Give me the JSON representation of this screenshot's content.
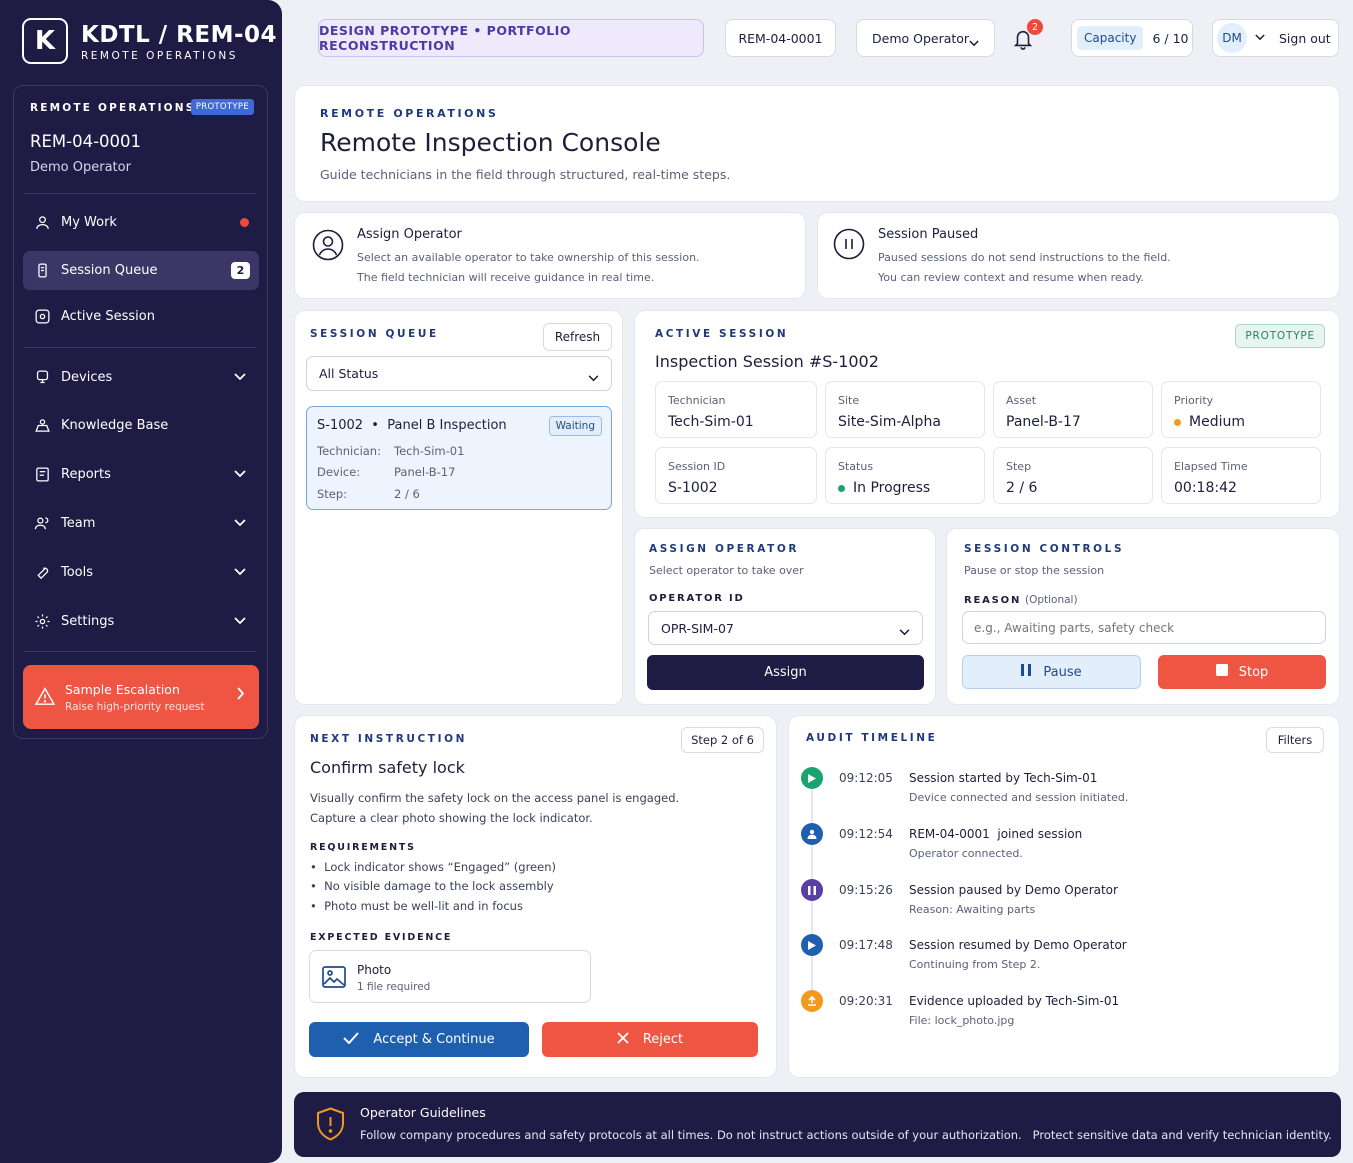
{
  "brand": {
    "logo_letter": "K",
    "title": "KDTL / REM-04",
    "subtitle": "REMOTE OPERATIONS"
  },
  "sidebar": {
    "panel_heading": "REMOTE OPERATIONS",
    "panel_badge": "PROTOTYPE",
    "session_id": "REM-04-0001",
    "operator": "Demo Operator",
    "nav": [
      {
        "label": "My Work",
        "icon": "user-icon"
      },
      {
        "label": "Session Queue",
        "icon": "queue-icon",
        "count": "2"
      },
      {
        "label": "Active Session",
        "icon": "active-session-icon"
      },
      {
        "label": "Devices",
        "icon": "devices-icon"
      },
      {
        "label": "Knowledge Base",
        "icon": "knowledge-icon"
      },
      {
        "label": "Reports",
        "icon": "reports-icon"
      },
      {
        "label": "Team",
        "icon": "team-icon"
      },
      {
        "label": "Tools",
        "icon": "tools-icon"
      },
      {
        "label": "Settings",
        "icon": "settings-icon"
      }
    ],
    "escalation": {
      "title": "Sample Escalation",
      "subtitle": "Raise high-priority request"
    }
  },
  "topbar": {
    "prototype_label": "DESIGN PROTOTYPE • PORTFOLIO RECONSTRUCTION",
    "session_id": "REM-04-0001",
    "operator_select": "Demo Operator",
    "notification_count": "2",
    "capacity_label": "Capacity",
    "capacity_value": "6 / 10",
    "avatar_initials": "DM",
    "sign_out": "Sign out"
  },
  "header": {
    "eyebrow": "REMOTE OPERATIONS",
    "title": "Remote Inspection Console",
    "subtitle": "Guide technicians in the field through structured, real-time steps."
  },
  "info_cards": [
    {
      "title": "Assign Operator",
      "line1": "Select an available operator to take ownership of this session.",
      "line2": "The field technician will receive guidance in real time."
    },
    {
      "title": "Session Paused",
      "line1": "Paused sessions do not send instructions to the field.",
      "line2": "You can review context and resume when ready."
    }
  ],
  "queue": {
    "heading": "SESSION QUEUE",
    "refresh": "Refresh",
    "filter": "All Status",
    "item": {
      "id": "S-1002",
      "sep": "•",
      "title": "Panel B Inspection",
      "status": "Waiting",
      "technician_label": "Technician:",
      "technician": "Tech-Sim-01",
      "device_label": "Device:",
      "device": "Panel-B-17",
      "step_label": "Step:",
      "step": "2 / 6"
    }
  },
  "active_session": {
    "eyebrow": "ACTIVE SESSION",
    "title": "Inspection Session #S-1002",
    "badge": "PROTOTYPE",
    "tiles": [
      {
        "label": "Technician",
        "value": "Tech-Sim-01"
      },
      {
        "label": "Site",
        "value": "Site-Sim-Alpha"
      },
      {
        "label": "Asset",
        "value": "Panel-B-17"
      },
      {
        "label": "Priority",
        "value": "Medium",
        "dot": "#f39a1e"
      },
      {
        "label": "Session ID",
        "value": "S-1002"
      },
      {
        "label": "Status",
        "value": "In Progress",
        "dot": "#1aa36f"
      },
      {
        "label": "Step",
        "value": "2 / 6"
      },
      {
        "label": "Elapsed Time",
        "value": "00:18:42"
      }
    ]
  },
  "assign": {
    "eyebrow": "ASSIGN OPERATOR",
    "desc": "Select operator to take over",
    "field_label": "OPERATOR ID",
    "value": "OPR-SIM-07",
    "button": "Assign"
  },
  "controls": {
    "eyebrow": "SESSION CONTROLS",
    "desc": "Pause or stop the session",
    "field_label": "REASON",
    "optional": "(Optional)",
    "placeholder": "e.g., Awaiting parts, safety check",
    "pause": "Pause",
    "stop": "Stop"
  },
  "instruction": {
    "eyebrow": "NEXT INSTRUCTION",
    "step_badge": "Step 2 of 6",
    "title": "Confirm safety lock",
    "line1": "Visually confirm the safety lock on the access panel is engaged.",
    "line2": "Capture a clear photo showing the lock indicator.",
    "req_label": "REQUIREMENTS",
    "requirements": [
      "Lock indicator shows “Engaged” (green)",
      "No visible damage to the lock assembly",
      "Photo must be well-lit and in focus"
    ],
    "evidence_label": "EXPECTED EVIDENCE",
    "evidence_title": "Photo",
    "evidence_sub": "1 file required",
    "accept": "Accept & Continue",
    "reject": "Reject"
  },
  "audit": {
    "eyebrow": "AUDIT TIMELINE",
    "filters": "Filters",
    "items": [
      {
        "time": "09:12:05",
        "title": "Session started by Tech-Sim-01",
        "desc": "Device connected and session initiated.",
        "color": "#1aa36f",
        "icon": "play-icon"
      },
      {
        "time": "09:12:54",
        "title": "REM-04-0001  joined session",
        "desc": "Operator connected.",
        "color": "#1f5fb0",
        "icon": "user-icon"
      },
      {
        "time": "09:15:26",
        "title": "Session paused by Demo Operator",
        "desc": "Reason: Awaiting parts",
        "color": "#5a3ea6",
        "icon": "pause-icon"
      },
      {
        "time": "09:17:48",
        "title": "Session resumed by Demo Operator",
        "desc": "Continuing from Step 2.",
        "color": "#1f5fb0",
        "icon": "play-icon"
      },
      {
        "time": "09:20:31",
        "title": "Evidence uploaded by Tech-Sim-01",
        "desc": "File: lock_photo.jpg",
        "color": "#f39a1e",
        "icon": "upload-icon"
      }
    ]
  },
  "footer": {
    "title": "Operator Guidelines",
    "text": "Follow company procedures and safety protocols at all times. Do not instruct actions outside of your authorization.   Protect sensitive data and verify technician identity."
  }
}
